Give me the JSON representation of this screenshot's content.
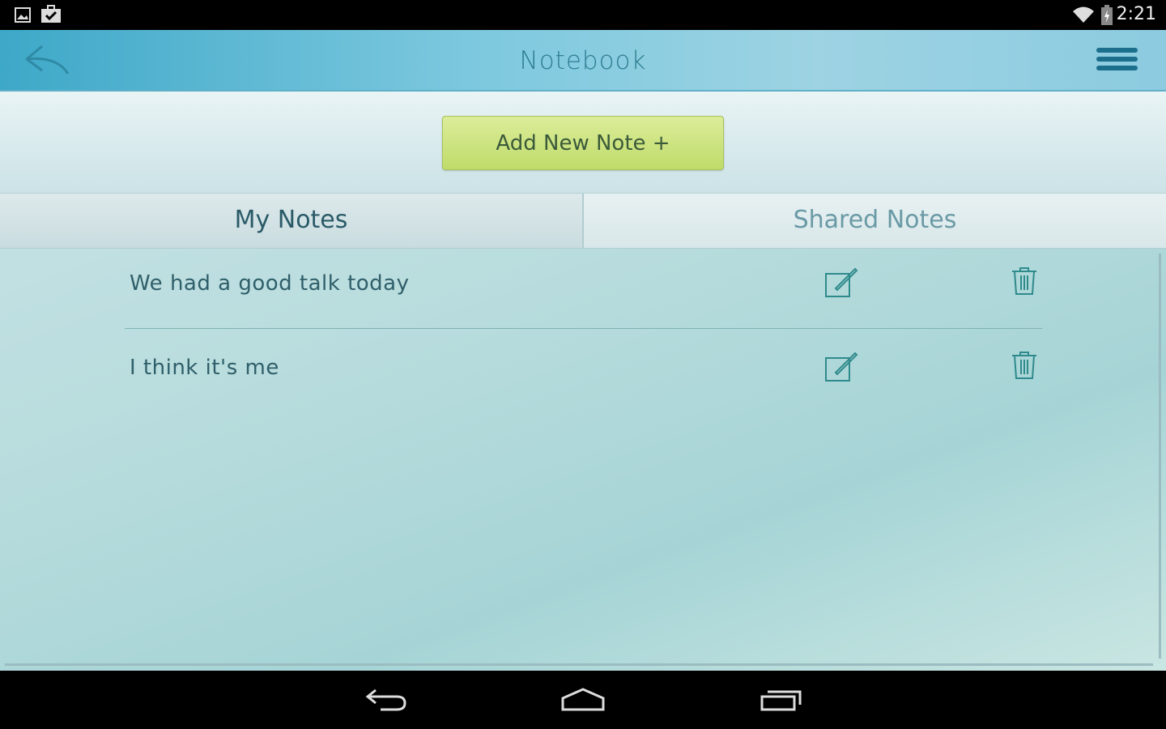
{
  "status_bar": {
    "time": "2:21",
    "icons": [
      "image-icon",
      "task-icon",
      "wifi-icon",
      "battery-icon"
    ]
  },
  "app_bar": {
    "title": "Notebook",
    "back_icon": "reply-arrow-icon",
    "menu_icon": "hamburger-menu-icon"
  },
  "add_button": {
    "label": "Add New Note +",
    "color": "#c8e27a"
  },
  "tabs": [
    {
      "label": "My Notes",
      "active": true
    },
    {
      "label": "Shared Notes",
      "active": false
    }
  ],
  "notes": [
    {
      "text": "We had a good talk today"
    },
    {
      "text": "I think it's me"
    }
  ],
  "nav_bar": {
    "icons": [
      "back-icon",
      "home-icon",
      "recents-icon"
    ]
  }
}
